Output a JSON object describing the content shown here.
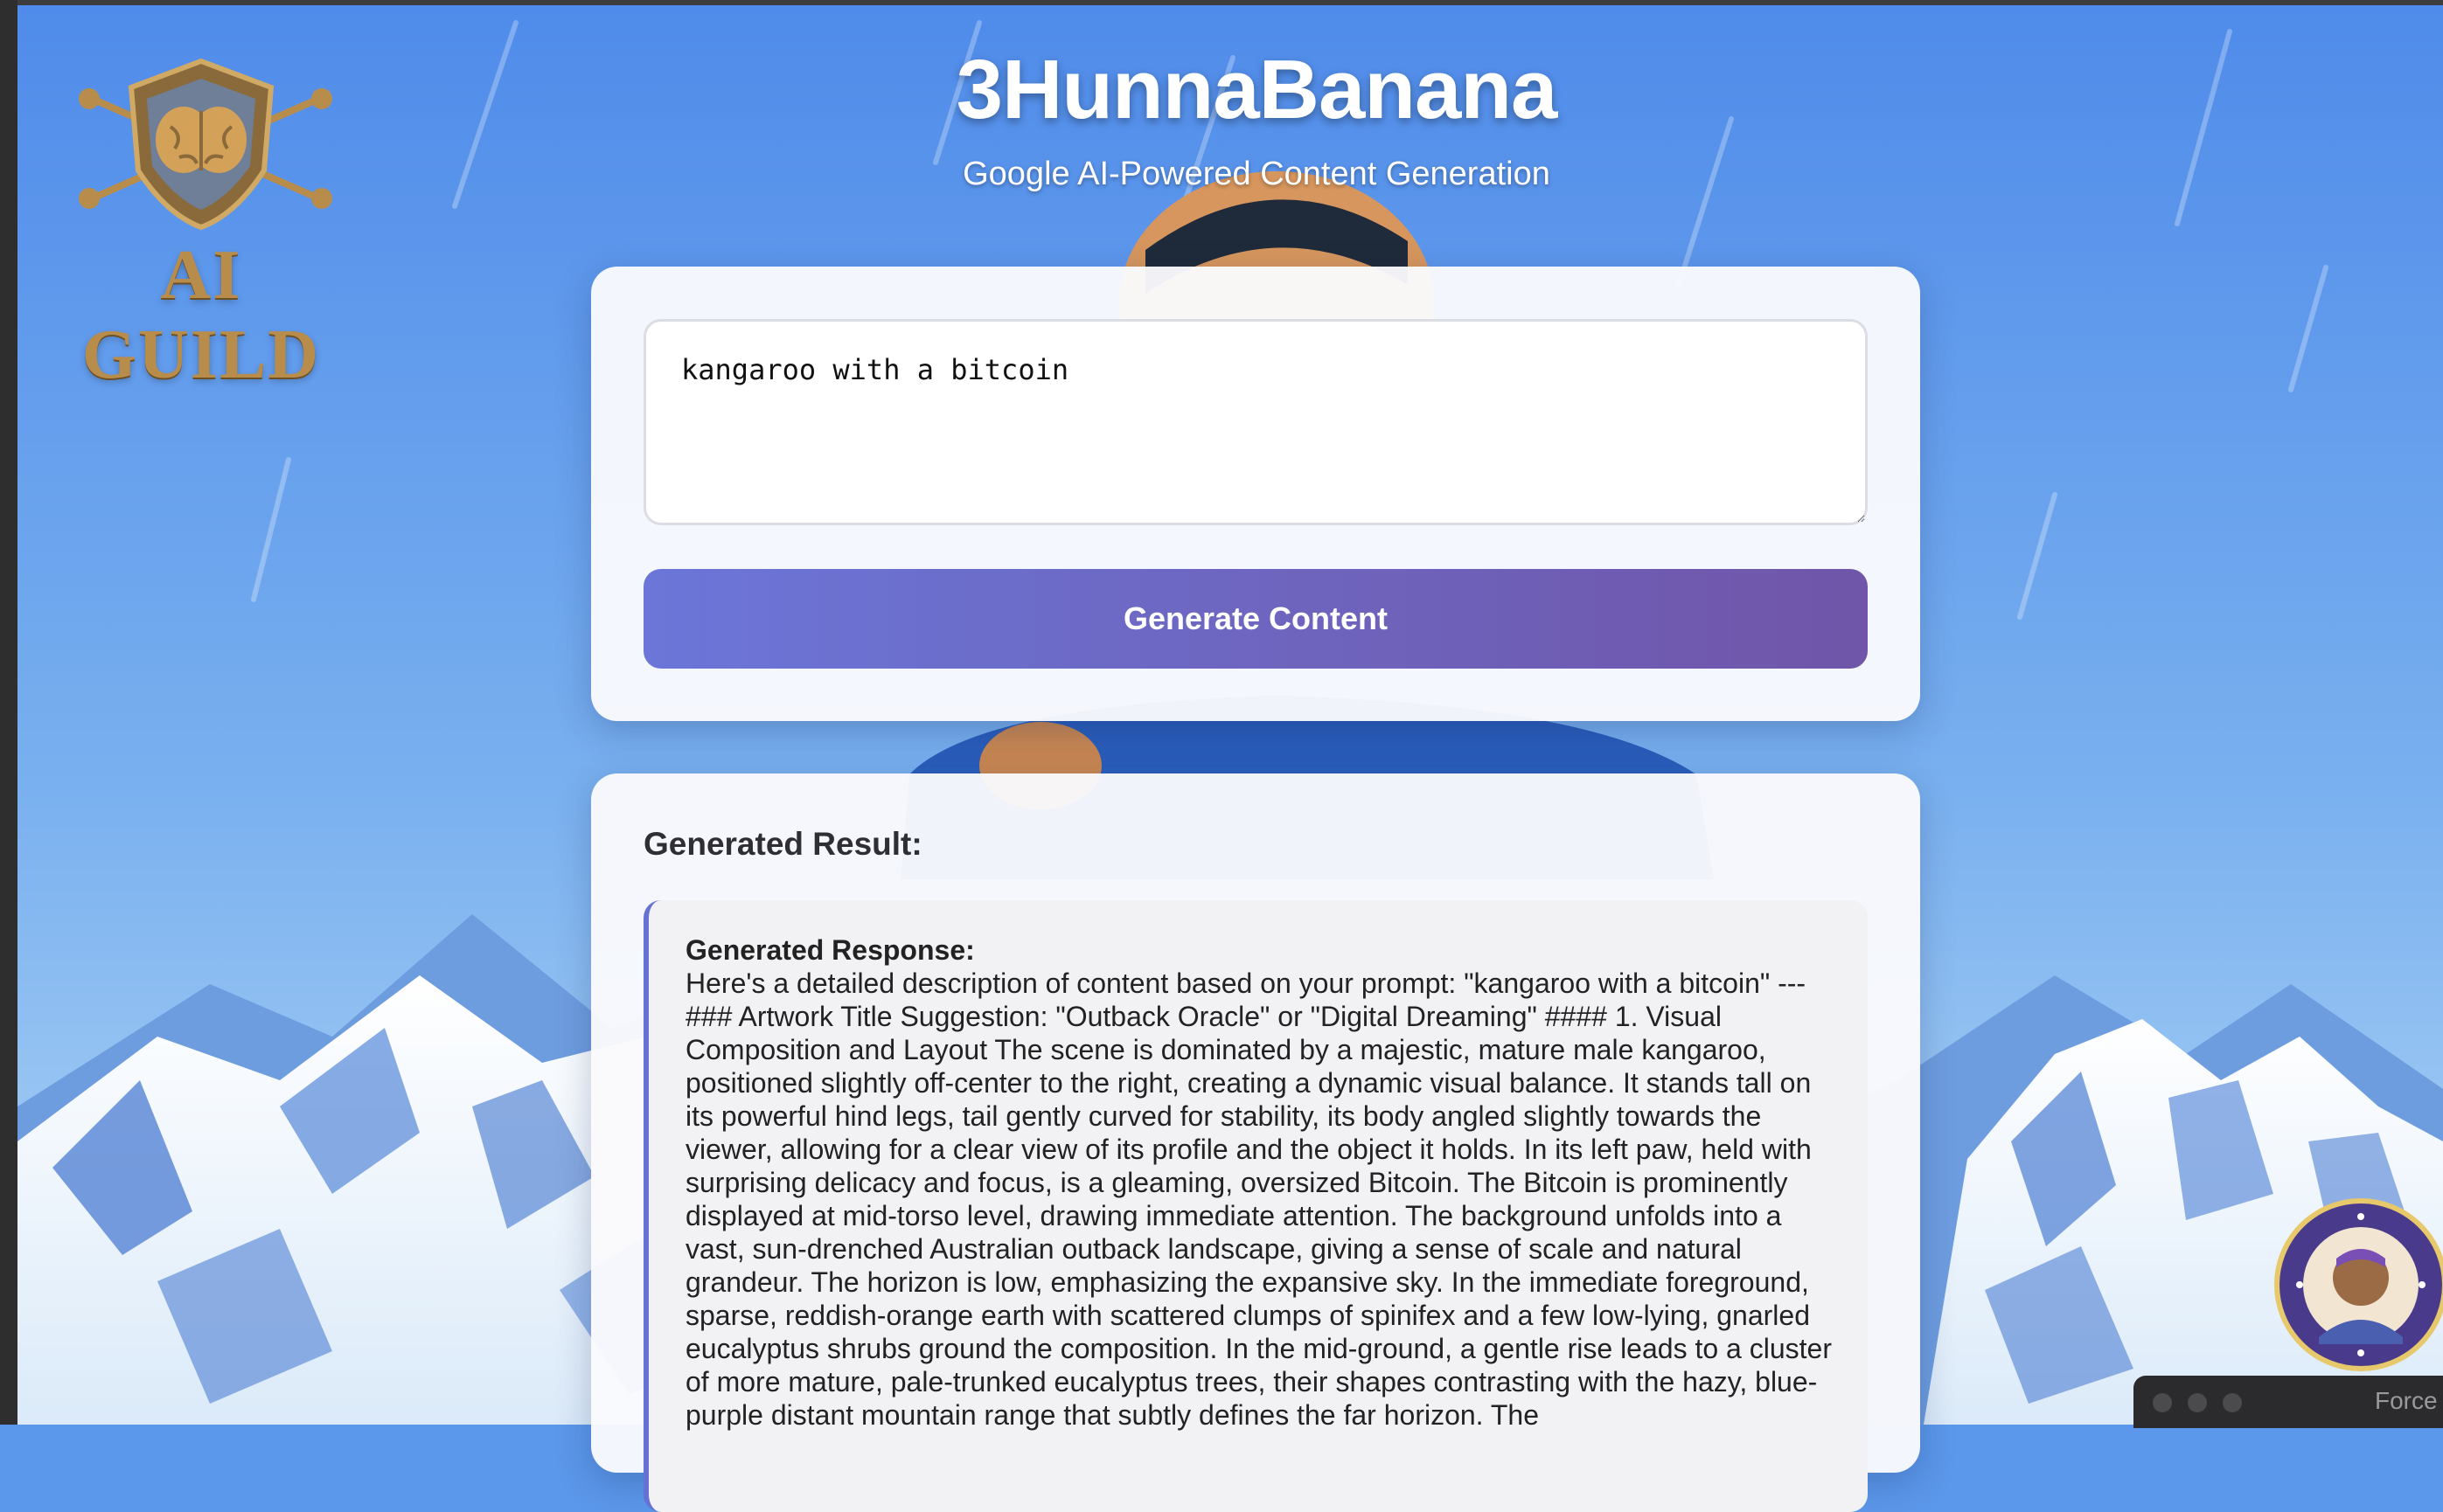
{
  "app": {
    "title": "3HunnaBanana",
    "subtitle": "Google AI-Powered Content Generation"
  },
  "logo": {
    "text": "AI GUILD",
    "icon": "brain-shield-icon"
  },
  "prompt": {
    "value": "kangaroo with a bitcoin"
  },
  "generate_button": {
    "label": "Generate Content"
  },
  "result": {
    "heading": "Generated Result:",
    "response_label": "Generated Response:",
    "response_text": "Here's a detailed description of content based on your prompt: \"kangaroo with a bitcoin\" --- ### Artwork Title Suggestion: \"Outback Oracle\" or \"Digital Dreaming\" #### 1. Visual Composition and Layout The scene is dominated by a majestic, mature male kangaroo, positioned slightly off-center to the right, creating a dynamic visual balance. It stands tall on its powerful hind legs, tail gently curved for stability, its body angled slightly towards the viewer, allowing for a clear view of its profile and the object it holds. In its left paw, held with surprising delicacy and focus, is a gleaming, oversized Bitcoin. The Bitcoin is prominently displayed at mid-torso level, drawing immediate attention. The background unfolds into a vast, sun-drenched Australian outback landscape, giving a sense of scale and natural grandeur. The horizon is low, emphasizing the expansive sky. In the immediate foreground, sparse, reddish-orange earth with scattered clumps of spinifex and a few low-lying, gnarled eucalyptus shrubs ground the composition. In the mid-ground, a gentle rise leads to a cluster of more mature, pale-trunked eucalyptus trees, their shapes contrasting with the hazy, blue-purple distant mountain range that subtly defines the far horizon. The"
  },
  "badge": {
    "icon": "community-badge-icon"
  },
  "dock": {
    "label": "Force"
  },
  "colors": {
    "background_sky": "#5b97ea",
    "button_start": "#6b76d8",
    "button_end": "#7055a8",
    "result_accent": "#6671d4"
  }
}
